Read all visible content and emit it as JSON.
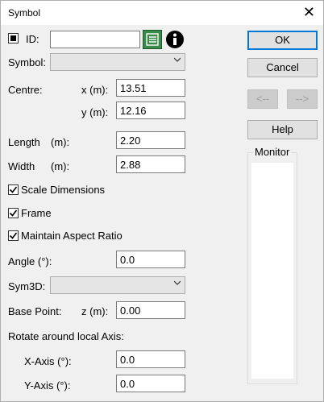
{
  "window": {
    "title": "Symbol",
    "close_glyph": "✕"
  },
  "id": {
    "label": "ID:",
    "value": ""
  },
  "symbol": {
    "label": "Symbol:",
    "selected": ""
  },
  "centre": {
    "label": "Centre:",
    "x_label": "x (m):",
    "x_value": "13.51",
    "y_label": "y (m):",
    "y_value": "12.16"
  },
  "length": {
    "label": "Length",
    "unit": "(m):",
    "value": "2.20"
  },
  "width": {
    "label": "Width",
    "unit": "(m):",
    "value": "2.88"
  },
  "checkboxes": [
    {
      "label": "Scale Dimensions",
      "checked": true
    },
    {
      "label": "Frame",
      "checked": true
    },
    {
      "label": "Maintain Aspect Ratio",
      "checked": true
    }
  ],
  "angle": {
    "label": "Angle (°):",
    "value": "0.0"
  },
  "sym3d": {
    "label": "Sym3D:",
    "selected": ""
  },
  "base_point": {
    "label": "Base Point:",
    "z_label": "z (m):",
    "z_value": "0.00"
  },
  "rotate": {
    "label": "Rotate around local Axis:",
    "x_label": "X-Axis (°):",
    "x_value": "0.0",
    "y_label": "Y-Axis (°):",
    "y_value": "0.0"
  },
  "buttons": {
    "ok": "OK",
    "cancel": "Cancel",
    "prev": "<--",
    "next": "-->",
    "help": "Help"
  },
  "monitor": {
    "label": "Monitor"
  },
  "colors": {
    "accent": "#0078d7",
    "window_bg": "#f0f0f0",
    "icon_green": "#3a8a4a"
  }
}
